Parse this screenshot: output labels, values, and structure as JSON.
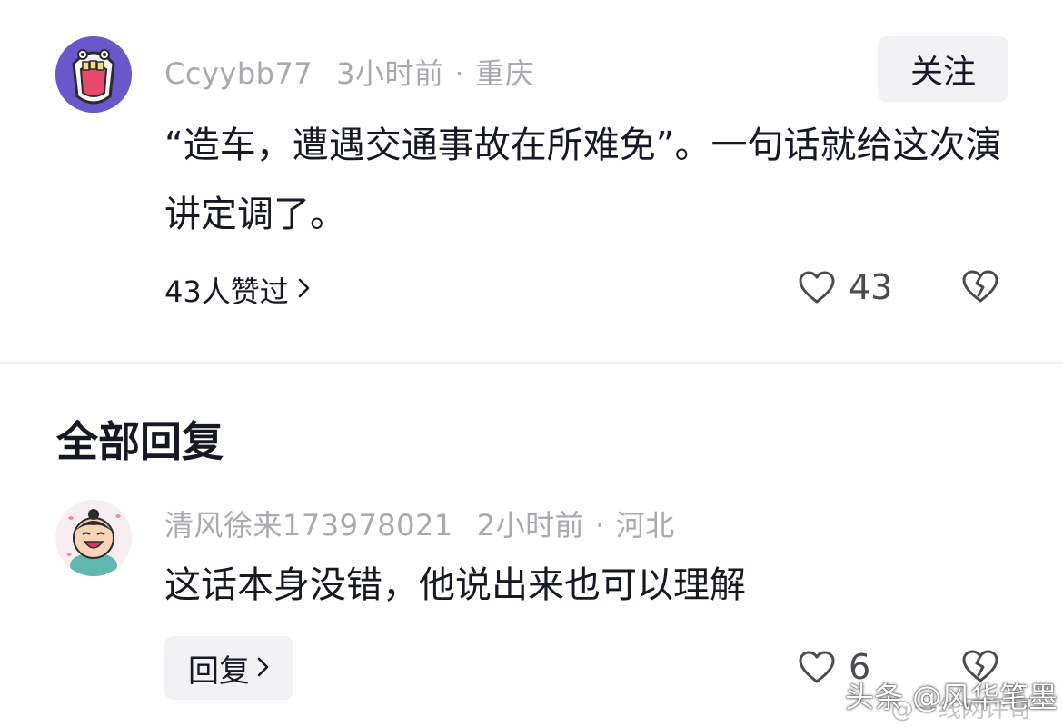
{
  "main_comment": {
    "username": "Ccyybb77",
    "time": "3小时前",
    "separator": "·",
    "location": "重庆",
    "follow_label": "关注",
    "text": "“造车，遭遇交通事故在所难免”。一句话就给这次演讲定调了。",
    "likers_label": "43人赞过",
    "like_count": "43",
    "avatar_icon": "cartoon-screaming-mouth-avatar"
  },
  "replies_section": {
    "title": "全部回复"
  },
  "reply": {
    "username": "清风徐来173978021",
    "time": "2小时前",
    "separator": "·",
    "location": "河北",
    "text": "这话本身没错，他说出来也可以理解",
    "reply_label": "回复",
    "like_count": "6",
    "avatar_icon": "cartoon-laughing-boy-avatar"
  },
  "watermark": {
    "text": "头条 @风华笔墨",
    "sub_text": "@一线网评哥"
  },
  "colors": {
    "text_primary": "#161823",
    "text_meta": "#a9a9ae",
    "button_bg": "#f2f2f4",
    "avatar_main_bg": "#6a57c9"
  }
}
